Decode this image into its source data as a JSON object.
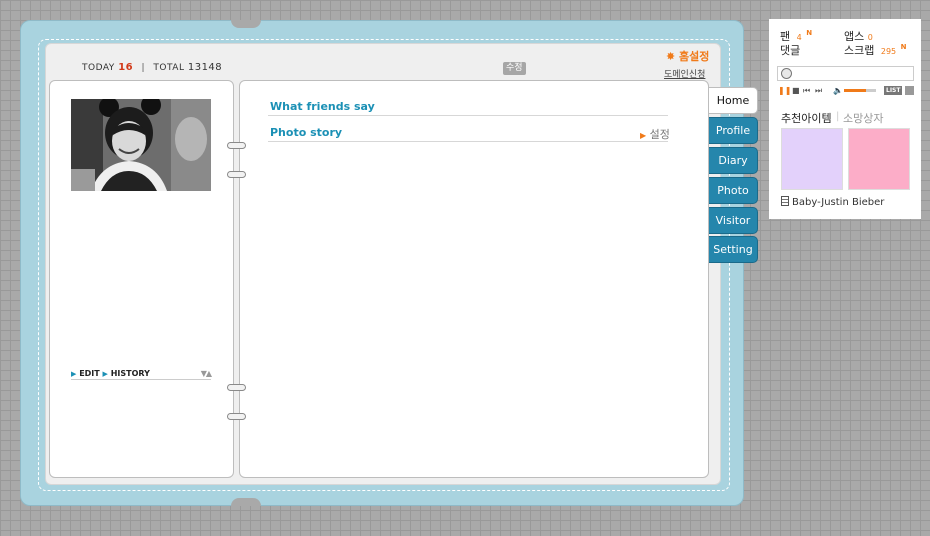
{
  "counter": {
    "today_label": "TODAY",
    "today_value": "16",
    "separator": "|",
    "total_label": "TOTAL",
    "total_value": "13148"
  },
  "header": {
    "edit_tag": "수정",
    "home_settings": "✸ 홈설정",
    "domain_link": "도메인신청"
  },
  "left": {
    "edit_label": "EDIT",
    "history_label": "HISTORY"
  },
  "main": {
    "sections": [
      {
        "title": "What friends say"
      },
      {
        "title": "Photo story",
        "settings_label": "설정"
      }
    ]
  },
  "tabs": [
    {
      "label": "Home",
      "active": true
    },
    {
      "label": "Profile",
      "active": false
    },
    {
      "label": "Diary",
      "active": false
    },
    {
      "label": "Photo",
      "active": false
    },
    {
      "label": "Visitor",
      "active": false
    },
    {
      "label": "Setting",
      "active": false
    }
  ],
  "side": {
    "fan_label": "팬",
    "fan_count": "4",
    "apps_label": "앱스",
    "apps_count": "0",
    "comment_label": "댓글",
    "scrap_label": "스크랩",
    "scrap_count": "295",
    "new_badge": "N",
    "list_label": "LIST",
    "recommend_label": "추천아이템",
    "wish_label": "소망상자",
    "song_title": "Baby-Justin Bieber",
    "volume_level": 0.7
  },
  "colors": {
    "book": "#a9d3df",
    "tab": "#2586ac",
    "accent": "#f07a19",
    "link": "#1b90b5",
    "item_purple": "#e3d1fb",
    "item_pink": "#fcadc8"
  }
}
